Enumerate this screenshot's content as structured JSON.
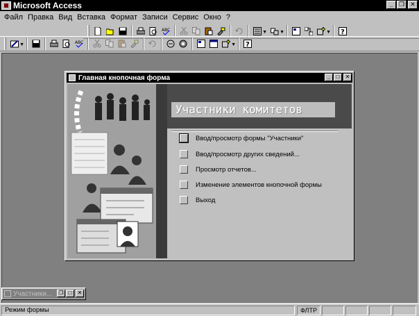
{
  "app": {
    "title": "Microsoft Access"
  },
  "menu": [
    "Файл",
    "Правка",
    "Вид",
    "Вставка",
    "Формат",
    "Записи",
    "Сервис",
    "Окно",
    "?"
  ],
  "menu_underline": [
    "Ф",
    "П",
    "В",
    "с",
    "Ф",
    "З",
    "С",
    "О",
    "?"
  ],
  "form": {
    "title": "Главная кнопочная форма",
    "heading": "Участники комитетов",
    "options": [
      "Ввод/просмотр формы \"Участники\"",
      "Ввод/просмотр других сведений...",
      "Просмотр отчетов...",
      "Изменение элементов кнопочной формы",
      "Выход"
    ]
  },
  "minimized": {
    "title": "Участники..."
  },
  "status": {
    "text": "Режим формы",
    "indicator": "ФЛТР"
  },
  "icons": {
    "toolbar1": [
      "new-icon",
      "open-icon",
      "save-icon",
      "print-icon",
      "preview-icon",
      "spell-icon",
      "cut-icon",
      "copy-icon",
      "paste-icon",
      "format-painter-icon",
      "undo-icon",
      "insert-object-icon",
      "analyze-icon",
      "properties-icon",
      "relationships-icon",
      "new-object-icon",
      "help-icon"
    ],
    "toolbar2": [
      "view-icon",
      "save-icon",
      "print-icon",
      "preview-icon",
      "spell-icon",
      "cut-icon",
      "copy-icon",
      "paste-icon",
      "format-painter-icon",
      "undo-icon",
      "sort-icon",
      "filter-icon",
      "properties-icon",
      "database-window-icon",
      "new-object-icon",
      "help-icon"
    ]
  },
  "colors": {
    "titlebar": "#000000",
    "workspace": "#808080",
    "face": "#c0c0c0"
  }
}
